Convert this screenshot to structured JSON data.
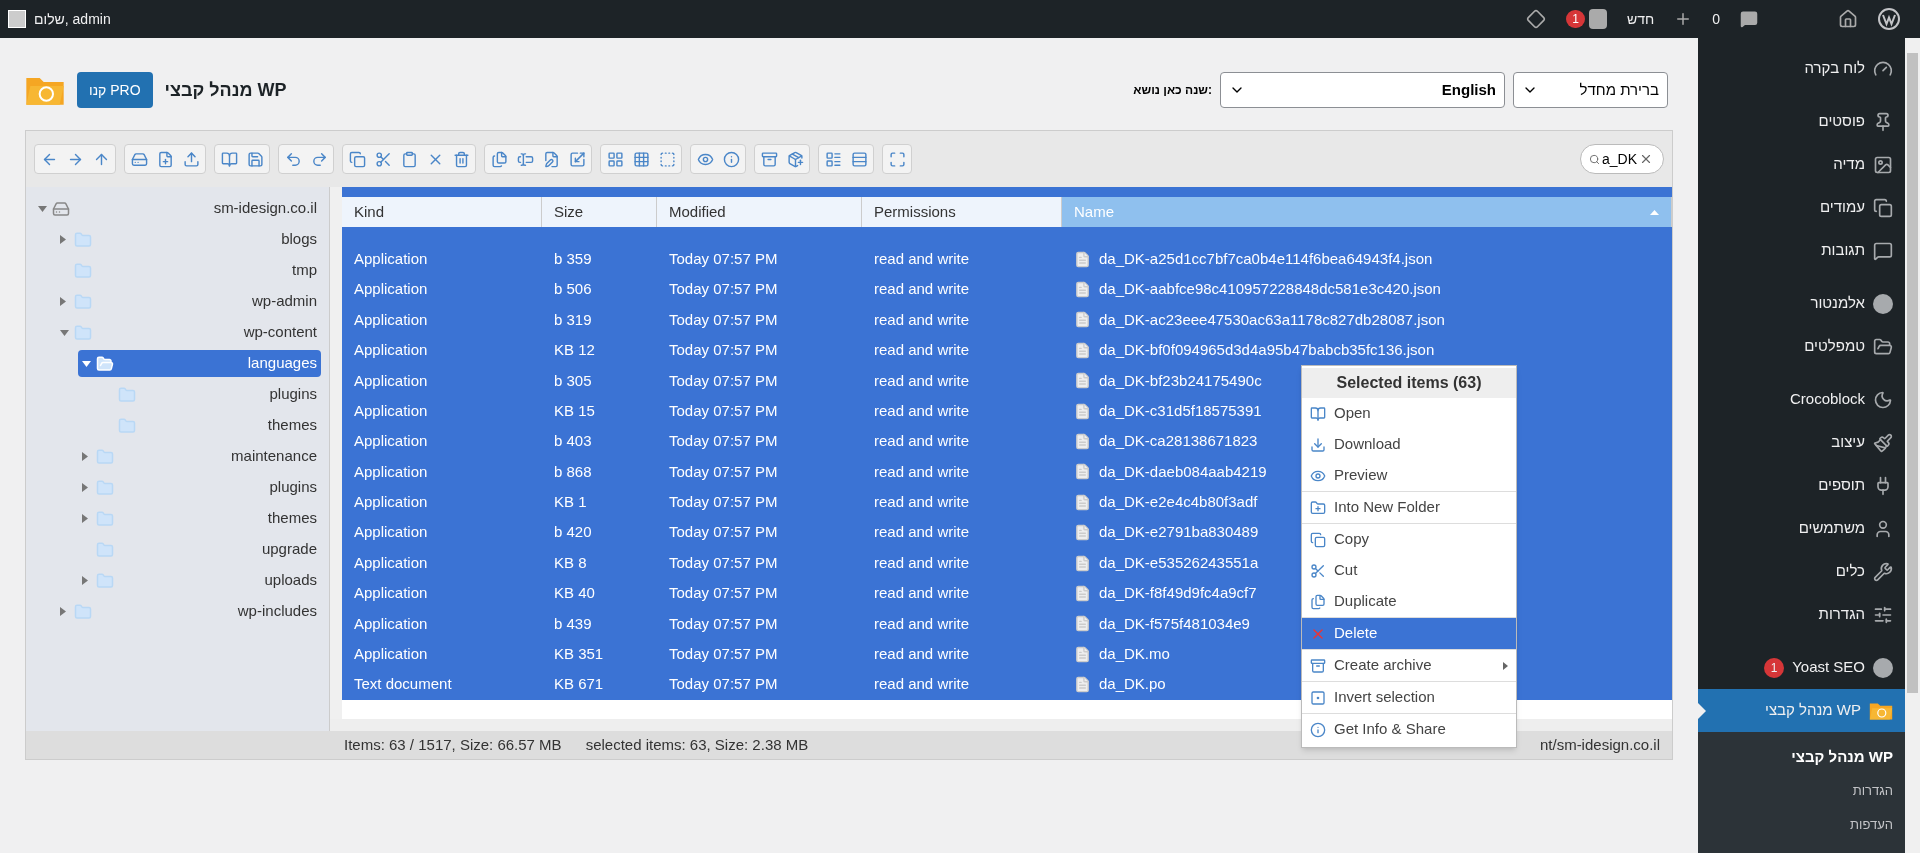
{
  "topbar": {
    "greeting": "שלום, admin",
    "comments_count": "0",
    "new_label": "חדש",
    "yoast_badge": "1"
  },
  "header": {
    "title": "מנהל קבצי WP",
    "pro_button": "קנו PRO",
    "theme_label": "שנה כאן נושא:",
    "language_select": "English",
    "theme_select": "ברירת מחדל"
  },
  "search": {
    "value": "a_DK"
  },
  "tree": [
    {
      "label": "sm-idesign.co.il",
      "kind": "drive",
      "expanded": true,
      "has_children": true,
      "selected": false,
      "children": [
        {
          "label": "blogs",
          "kind": "folder",
          "expanded": false,
          "has_children": true,
          "selected": false
        },
        {
          "label": "tmp",
          "kind": "folder",
          "expanded": false,
          "has_children": false,
          "selected": false
        },
        {
          "label": "wp-admin",
          "kind": "folder",
          "expanded": false,
          "has_children": true,
          "selected": false
        },
        {
          "label": "wp-content",
          "kind": "folder",
          "expanded": true,
          "has_children": true,
          "selected": false,
          "children": [
            {
              "label": "languages",
              "kind": "folder",
              "expanded": true,
              "has_children": true,
              "selected": true,
              "children": [
                {
                  "label": "plugins",
                  "kind": "folder",
                  "expanded": false,
                  "has_children": false,
                  "selected": false
                },
                {
                  "label": "themes",
                  "kind": "folder",
                  "expanded": false,
                  "has_children": false,
                  "selected": false
                }
              ]
            },
            {
              "label": "maintenance",
              "kind": "folder",
              "expanded": false,
              "has_children": true,
              "selected": false
            },
            {
              "label": "plugins",
              "kind": "folder",
              "expanded": false,
              "has_children": true,
              "selected": false
            },
            {
              "label": "themes",
              "kind": "folder",
              "expanded": false,
              "has_children": true,
              "selected": false
            },
            {
              "label": "upgrade",
              "kind": "folder",
              "expanded": false,
              "has_children": false,
              "selected": false
            },
            {
              "label": "uploads",
              "kind": "folder",
              "expanded": false,
              "has_children": true,
              "selected": false
            }
          ]
        },
        {
          "label": "wp-includes",
          "kind": "folder",
          "expanded": false,
          "has_children": true,
          "selected": false
        }
      ]
    }
  ],
  "table": {
    "columns": [
      {
        "label": "Kind",
        "sorted": false
      },
      {
        "label": "Size",
        "sorted": false
      },
      {
        "label": "Modified",
        "sorted": false
      },
      {
        "label": "Permissions",
        "sorted": false
      },
      {
        "label": "Name",
        "sorted": true
      }
    ],
    "rows": [
      {
        "kind": "Application",
        "size": "b 359",
        "modified": "Today 07:57 PM",
        "permissions": "read and write",
        "name": "da_DK-a25d1cc7bf7ca0b4e114f6bea64943f4.json",
        "selected": true
      },
      {
        "kind": "Application",
        "size": "b 506",
        "modified": "Today 07:57 PM",
        "permissions": "read and write",
        "name": "da_DK-aabfce98c410957228848dc581e3c420.json",
        "selected": true
      },
      {
        "kind": "Application",
        "size": "b 319",
        "modified": "Today 07:57 PM",
        "permissions": "read and write",
        "name": "da_DK-ac23eee47530ac63a1178c827db28087.json",
        "selected": true
      },
      {
        "kind": "Application",
        "size": "KB 12",
        "modified": "Today 07:57 PM",
        "permissions": "read and write",
        "name": "da_DK-bf0f094965d3d4a95b47babcb35fc136.json",
        "selected": true
      },
      {
        "kind": "Application",
        "size": "b 305",
        "modified": "Today 07:57 PM",
        "permissions": "read and write",
        "name": "da_DK-bf23b24175490c",
        "selected": true
      },
      {
        "kind": "Application",
        "size": "KB 15",
        "modified": "Today 07:57 PM",
        "permissions": "read and write",
        "name": "da_DK-c31d5f18575391",
        "selected": true
      },
      {
        "kind": "Application",
        "size": "b 403",
        "modified": "Today 07:57 PM",
        "permissions": "read and write",
        "name": "da_DK-ca28138671823",
        "selected": true
      },
      {
        "kind": "Application",
        "size": "b 868",
        "modified": "Today 07:57 PM",
        "permissions": "read and write",
        "name": "da_DK-daeb084aab4219",
        "selected": true
      },
      {
        "kind": "Application",
        "size": "KB 1",
        "modified": "Today 07:57 PM",
        "permissions": "read and write",
        "name": "da_DK-e2e4c4b80f3adf",
        "selected": true
      },
      {
        "kind": "Application",
        "size": "b 420",
        "modified": "Today 07:57 PM",
        "permissions": "read and write",
        "name": "da_DK-e2791ba830489",
        "selected": true
      },
      {
        "kind": "Application",
        "size": "KB 8",
        "modified": "Today 07:57 PM",
        "permissions": "read and write",
        "name": "da_DK-e53526243551a",
        "selected": true
      },
      {
        "kind": "Application",
        "size": "KB 40",
        "modified": "Today 07:57 PM",
        "permissions": "read and write",
        "name": "da_DK-f8f49d9fc4a9cf7",
        "selected": true
      },
      {
        "kind": "Application",
        "size": "b 439",
        "modified": "Today 07:57 PM",
        "permissions": "read and write",
        "name": "da_DK-f575f481034e9",
        "selected": true
      },
      {
        "kind": "Application",
        "size": "KB 351",
        "modified": "Today 07:57 PM",
        "permissions": "read and write",
        "name": "da_DK.mo",
        "selected": true
      },
      {
        "kind": "Text document",
        "size": "KB 671",
        "modified": "Today 07:57 PM",
        "permissions": "read and write",
        "name": "da_DK.po",
        "selected": true
      }
    ]
  },
  "context_menu": {
    "title": "Selected items (63)",
    "groups": [
      [
        {
          "label": "Open",
          "selected": false,
          "submenu": false
        },
        {
          "label": "Download",
          "selected": false,
          "submenu": false
        },
        {
          "label": "Preview",
          "selected": false,
          "submenu": false
        }
      ],
      [
        {
          "label": "Into New Folder",
          "selected": false,
          "submenu": false
        }
      ],
      [
        {
          "label": "Copy",
          "selected": false,
          "submenu": false
        },
        {
          "label": "Cut",
          "selected": false,
          "submenu": false
        },
        {
          "label": "Duplicate",
          "selected": false,
          "submenu": false
        }
      ],
      [
        {
          "label": "Delete",
          "selected": true,
          "submenu": false
        }
      ],
      [
        {
          "label": "Create archive",
          "selected": false,
          "submenu": true
        }
      ],
      [
        {
          "label": "Invert selection",
          "selected": false,
          "submenu": false
        }
      ],
      [
        {
          "label": "Get Info & Share",
          "selected": false,
          "submenu": false
        }
      ]
    ]
  },
  "status_bar": {
    "items": "Items: 63 / 1517, Size: 66.57 MB",
    "selected": "selected items: 63, Size: 2.38 MB",
    "path": "nt/sm-idesign.co.il"
  },
  "sidebar": {
    "groups": [
      [
        {
          "label": "לוח בקרה",
          "selected": false
        }
      ],
      [
        {
          "label": "פוסטים",
          "selected": false
        },
        {
          "label": "מדיה",
          "selected": false
        },
        {
          "label": "עמודים",
          "selected": false
        },
        {
          "label": "תגובות",
          "selected": false
        }
      ],
      [
        {
          "label": "אלמנטור",
          "selected": false
        },
        {
          "label": "טמפלטים",
          "selected": false
        }
      ],
      [
        {
          "label": "Crocoblock",
          "selected": false
        },
        {
          "label": "עיצוב",
          "selected": false
        },
        {
          "label": "תוספים",
          "selected": false
        },
        {
          "label": "משתמשים",
          "selected": false
        },
        {
          "label": "כלים",
          "selected": false
        },
        {
          "label": "הגדרות",
          "selected": false
        }
      ],
      [
        {
          "label": "Yoast SEO",
          "selected": false,
          "badge": "1"
        },
        {
          "label": "מנהל קבצי WP",
          "selected": true
        }
      ]
    ],
    "submenu": [
      {
        "label": "מנהל קבצי WP",
        "selected": true
      },
      {
        "label": "הגדרות",
        "selected": false
      },
      {
        "label": "העדפות",
        "selected": false
      }
    ]
  }
}
